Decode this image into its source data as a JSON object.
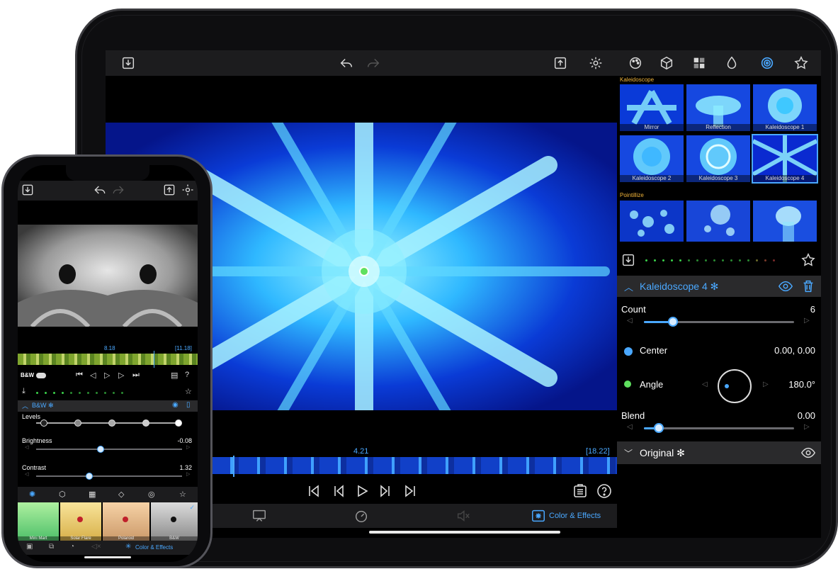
{
  "ipad": {
    "top_bar": {
      "icons": [
        "import-icon",
        "undo-icon",
        "redo-icon",
        "export-icon",
        "settings-icon",
        "palette-icon",
        "cube-icon",
        "grid-icon",
        "drop-icon",
        "spiral-icon",
        "star-icon"
      ]
    },
    "timeline": {
      "current_time": "4.21",
      "duration": "[18.22]"
    },
    "bottom_tabs": {
      "active_label": "Color & Effects"
    },
    "panel": {
      "section_kaleidoscope": "Kaleidoscope",
      "kaleidoscope_presets": [
        "Mirror",
        "Reflection",
        "Kaleidoscope 1",
        "Kaleidoscope 2",
        "Kaleidoscope 3",
        "Kaleidoscope 4"
      ],
      "section_pointillize": "Pointillize",
      "effect_title": "Kaleidoscope 4 ✻",
      "params": {
        "count_label": "Count",
        "count_value": "6",
        "count_fraction": 0.12,
        "center_label": "Center",
        "center_value": "0.00, 0.00",
        "angle_label": "Angle",
        "angle_value": "180.0°",
        "blend_label": "Blend",
        "blend_value": "0.00",
        "blend_fraction": 0.02
      },
      "original_label": "Original ✻"
    },
    "colors": {
      "accent": "#4aa8ff",
      "section": "#f2b53a"
    }
  },
  "iphone": {
    "timeline": {
      "current_time": "8.18",
      "duration": "[11.18]"
    },
    "filter_label": "B&W",
    "effect_title": "B&W ✻",
    "params": {
      "levels_label": "Levels",
      "brightness_label": "Brightness",
      "brightness_value": "-0.08",
      "contrast_label": "Contrast",
      "contrast_value": "1.32"
    },
    "thumbs": [
      "Mini Mart",
      "Solar Flare",
      "Polaroid",
      "B&W"
    ],
    "bottom_tab_label": "Color & Effects"
  }
}
